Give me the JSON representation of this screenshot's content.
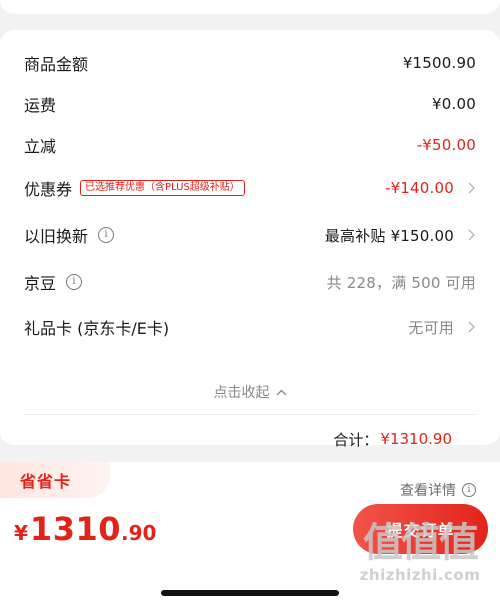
{
  "summary": {
    "rows": [
      {
        "label": "商品金额",
        "value": "¥1500.90"
      },
      {
        "label": "运费",
        "value": "¥0.00"
      },
      {
        "label": "立减",
        "value": "-¥50.00"
      },
      {
        "label": "优惠券",
        "tag": "已选推荐优惠（含PLUS超级补贴）",
        "value": "-¥140.00"
      },
      {
        "label": "以旧换新",
        "value": "最高补贴 ¥150.00"
      },
      {
        "label": "京豆",
        "value": "共 228，满 500 可用"
      },
      {
        "label": "礼品卡 (京东卡/E卡)",
        "value": "无可用"
      }
    ],
    "collapse_label": "点击收起",
    "total_label": "合计：",
    "total_value": "¥1310.90"
  },
  "footer": {
    "saving_card": "省省卡",
    "detail_link": "查看详情",
    "price_currency": "¥",
    "price_integer": "1310",
    "price_decimal": ".90",
    "submit_label": "提交订单"
  },
  "watermark": {
    "logo": "值值值",
    "url": "zhizhizhi.com"
  },
  "colors": {
    "accent": "#e2231a",
    "muted": "#8a8a8a",
    "background": "#f2f2f2"
  }
}
